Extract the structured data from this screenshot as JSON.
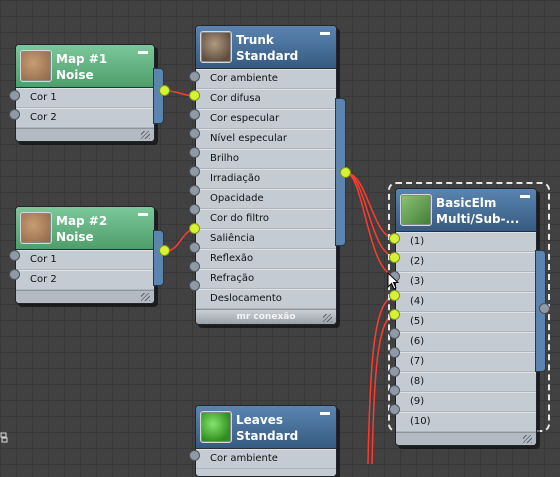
{
  "nodes": {
    "map1": {
      "title1": "Map #1",
      "title2": "Noise",
      "slots": [
        "Cor 1",
        "Cor 2"
      ]
    },
    "map2": {
      "title1": "Map #2",
      "title2": "Noise",
      "slots": [
        "Cor 1",
        "Cor 2"
      ]
    },
    "trunk": {
      "title1": "Trunk",
      "title2": "Standard",
      "slots": [
        "Cor ambiente",
        "Cor difusa",
        "Cor especular",
        "Nível especular",
        "Brilho",
        "Irradiação",
        "Opacidade",
        "Cor do filtro",
        "Saliência",
        "Reflexão",
        "Refração",
        "Deslocamento"
      ],
      "footer": "mr conexão"
    },
    "basic": {
      "title1": "BasicElm",
      "title2": "Multi/Sub-...",
      "slots": [
        "(1)",
        "(2)",
        "(3)",
        "(4)",
        "(5)",
        "(6)",
        "(7)",
        "(8)",
        "(9)",
        "(10)"
      ]
    },
    "leaves": {
      "title1": "Leaves",
      "title2": "Standard",
      "slots": [
        "Cor ambiente"
      ]
    }
  },
  "colors": {
    "wire": "#ff3a2e",
    "socket_active": "#d6f232",
    "header_green": "#5aa874",
    "header_blue": "#46709a"
  }
}
